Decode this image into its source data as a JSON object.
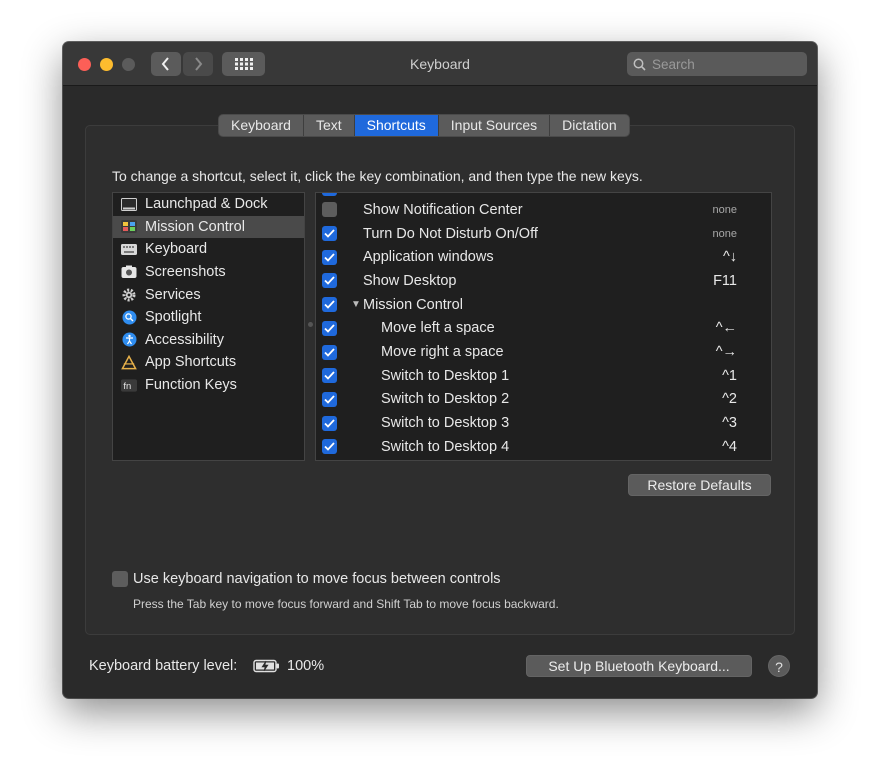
{
  "window": {
    "title": "Keyboard"
  },
  "search": {
    "placeholder": "Search"
  },
  "tabs": [
    {
      "label": "Keyboard",
      "active": false
    },
    {
      "label": "Text",
      "active": false
    },
    {
      "label": "Shortcuts",
      "active": true
    },
    {
      "label": "Input Sources",
      "active": false
    },
    {
      "label": "Dictation",
      "active": false
    }
  ],
  "instructions": "To change a shortcut, select it, click the key combination, and then type the new keys.",
  "categories": [
    {
      "label": "Launchpad & Dock",
      "icon": "launchpad-dock-icon",
      "selected": false
    },
    {
      "label": "Mission Control",
      "icon": "mission-control-icon",
      "selected": true
    },
    {
      "label": "Keyboard",
      "icon": "keyboard-icon",
      "selected": false
    },
    {
      "label": "Screenshots",
      "icon": "screenshots-icon",
      "selected": false
    },
    {
      "label": "Services",
      "icon": "gear-icon",
      "selected": false
    },
    {
      "label": "Spotlight",
      "icon": "spotlight-icon",
      "selected": false
    },
    {
      "label": "Accessibility",
      "icon": "accessibility-icon",
      "selected": false
    },
    {
      "label": "App Shortcuts",
      "icon": "app-shortcuts-icon",
      "selected": false
    },
    {
      "label": "Function Keys",
      "icon": "function-keys-icon",
      "selected": false
    }
  ],
  "shortcuts": [
    {
      "label": "Show Notification Center",
      "key": "none",
      "checked": false,
      "indent": false
    },
    {
      "label": "Turn Do Not Disturb On/Off",
      "key": "none",
      "checked": true,
      "indent": false
    },
    {
      "label": "Application windows",
      "key": "^↓",
      "checked": true,
      "indent": false
    },
    {
      "label": "Show Desktop",
      "key": "F11",
      "checked": true,
      "indent": false
    },
    {
      "label": "Mission Control",
      "key": "",
      "checked": true,
      "indent": false,
      "group": true
    },
    {
      "label": "Move left a space",
      "key": "^←",
      "checked": true,
      "indent": true
    },
    {
      "label": "Move right a space",
      "key": "^→",
      "checked": true,
      "indent": true
    },
    {
      "label": "Switch to Desktop 1",
      "key": "^1",
      "checked": true,
      "indent": true
    },
    {
      "label": "Switch to Desktop 2",
      "key": "^2",
      "checked": true,
      "indent": true
    },
    {
      "label": "Switch to Desktop 3",
      "key": "^3",
      "checked": true,
      "indent": true
    },
    {
      "label": "Switch to Desktop 4",
      "key": "^4",
      "checked": true,
      "indent": true
    }
  ],
  "restore_label": "Restore Defaults",
  "keyboard_nav": {
    "label": "Use keyboard navigation to move focus between controls",
    "sub": "Press the Tab key to move focus forward and Shift Tab to move focus backward.",
    "checked": false
  },
  "battery": {
    "label": "Keyboard battery level:",
    "value": "100%"
  },
  "bluetooth_button": "Set Up Bluetooth Keyboard...",
  "help_label": "?",
  "colors": {
    "accent": "#1f69dc",
    "window_bg": "#2a2a2a",
    "list_bg": "#1f1f1f"
  }
}
